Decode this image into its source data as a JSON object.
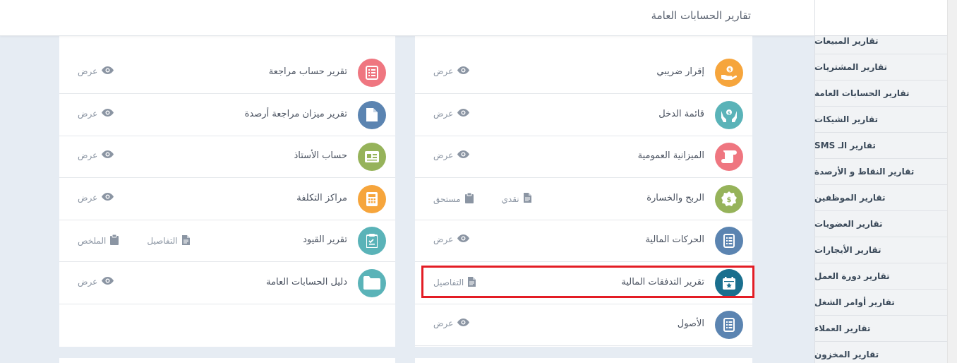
{
  "header": {
    "title": "تقارير الحسابات العامة"
  },
  "sidebar": {
    "items": [
      {
        "label": "تقارير المبيعات"
      },
      {
        "label": "تقارير المشتريات"
      },
      {
        "label": "تقارير الحسابات العامة"
      },
      {
        "label": "تقارير الشيكات"
      },
      {
        "label": "تقارير الـ SMS"
      },
      {
        "label": "تقارير النقاط و الأرصدة"
      },
      {
        "label": "تقارير الموظفين"
      },
      {
        "label": "تقارير العضويات"
      },
      {
        "label": "تقارير الأيجارات"
      },
      {
        "label": "تقارير دورة العمل"
      },
      {
        "label": "تقارير أوامر الشغل"
      },
      {
        "label": "تقارير العملاء"
      },
      {
        "label": "تقارير المخزون"
      }
    ]
  },
  "left_card": {
    "rows": [
      {
        "label": "تقرير حساب مراجعة",
        "icon": "checklist-icon",
        "color": "#ef7680",
        "actions": [
          {
            "label": "عرض",
            "icon": "eye-icon"
          }
        ]
      },
      {
        "label": "تقرير ميزان مراجعة أرصدة",
        "icon": "document-icon",
        "color": "#5b84b1",
        "actions": [
          {
            "label": "عرض",
            "icon": "eye-icon"
          }
        ]
      },
      {
        "label": "حساب الأستاذ",
        "icon": "id-card-icon",
        "color": "#96b35a",
        "actions": [
          {
            "label": "عرض",
            "icon": "eye-icon"
          }
        ]
      },
      {
        "label": "مراكز التكلفة",
        "icon": "calculator-icon",
        "color": "#f6a53c",
        "actions": [
          {
            "label": "عرض",
            "icon": "eye-icon"
          }
        ]
      },
      {
        "label": "تقرير القيود",
        "icon": "clipboard-check-icon",
        "color": "#5ab3b8",
        "actions": [
          {
            "label": "التفاصيل",
            "icon": "file-icon"
          },
          {
            "label": "الملخص",
            "icon": "clipboard-icon"
          }
        ]
      },
      {
        "label": "دليل الحسابات العامة",
        "icon": "folder-icon",
        "color": "#5ab3b8",
        "actions": [
          {
            "label": "عرض",
            "icon": "eye-icon"
          }
        ]
      }
    ]
  },
  "right_card": {
    "rows": [
      {
        "label": "إقرار ضريبي",
        "icon": "hand-coin-icon",
        "color": "#f6a53c",
        "actions": [
          {
            "label": "عرض",
            "icon": "eye-icon"
          }
        ]
      },
      {
        "label": "قائمة الدخل",
        "icon": "hands-money-icon",
        "color": "#5ab3b8",
        "actions": [
          {
            "label": "عرض",
            "icon": "eye-icon"
          }
        ]
      },
      {
        "label": "الميزانية العمومية",
        "icon": "scroll-icon",
        "color": "#ef7680",
        "actions": [
          {
            "label": "عرض",
            "icon": "eye-icon"
          }
        ]
      },
      {
        "label": "الربح والخسارة",
        "icon": "dollar-badge-icon",
        "color": "#96b35a",
        "actions": [
          {
            "label": "نقدي",
            "icon": "file-icon"
          },
          {
            "label": "مستحق",
            "icon": "clipboard-icon"
          }
        ]
      },
      {
        "label": "الحركات المالية",
        "icon": "list-icon",
        "color": "#5b84b1",
        "actions": [
          {
            "label": "عرض",
            "icon": "eye-icon"
          }
        ]
      },
      {
        "label": "تقرير التدفقات المالية",
        "icon": "calendar-star-icon",
        "color": "#1a6f8e",
        "actions": [
          {
            "label": "التفاصيل",
            "icon": "file-icon"
          }
        ]
      },
      {
        "label": "الأصول",
        "icon": "list-icon",
        "color": "#5b84b1",
        "actions": [
          {
            "label": "عرض",
            "icon": "eye-icon"
          }
        ]
      }
    ]
  }
}
